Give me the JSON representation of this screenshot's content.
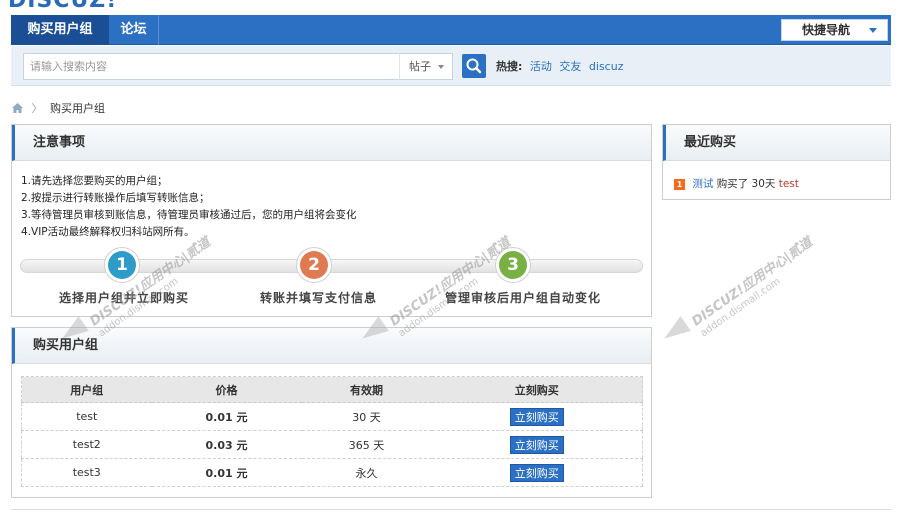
{
  "nav": {
    "logo": "DISCUZ!",
    "active_tab": "购买用户组",
    "forum_tab": "论坛",
    "quick_nav": "快捷导航"
  },
  "search": {
    "placeholder": "请输入搜索内容",
    "type": "帖子",
    "hot_label": "热搜:",
    "hot_terms": [
      "活动",
      "交友",
      "discuz"
    ]
  },
  "breadcrumb": {
    "current": "购买用户组"
  },
  "notice": {
    "title": "注意事项",
    "lines": [
      "1.请先选择您要购买的用户组；",
      "2.按提示进行转账操作后填写转账信息；",
      "3.等待管理员审核到账信息，待管理员审核通过后，您的用户组将会变化",
      "4.VIP活动最终解释权归科站网所有。"
    ],
    "steps": [
      {
        "num": "1",
        "label": "选择用户组并立即购买",
        "color": "#2f9bc9"
      },
      {
        "num": "2",
        "label": "转账并填写支付信息",
        "color": "#e07a50"
      },
      {
        "num": "3",
        "label": "管理审核后用户组自动变化",
        "color": "#79b043"
      }
    ]
  },
  "recent": {
    "title": "最近购买",
    "badge": "1",
    "user": "测试",
    "action": "购买了 30天",
    "group": "test"
  },
  "buy": {
    "title": "购买用户组",
    "headers": [
      "用户组",
      "价格",
      "有效期",
      "立刻购买"
    ],
    "rows": [
      {
        "group": "test",
        "price": "0.01 元",
        "period": "30 天",
        "button": "立刻购买"
      },
      {
        "group": "test2",
        "price": "0.03 元",
        "period": "365 天",
        "button": "立刻购买"
      },
      {
        "group": "test3",
        "price": "0.01 元",
        "period": "永久",
        "button": "立刻购买"
      }
    ]
  },
  "watermark": {
    "brand": "DISCUZ!应用中心|贰道",
    "url": "addon.dismall.com"
  },
  "colors": {
    "accent": "#2b70c2",
    "price": "#e00000",
    "badge": "#f26c1c"
  }
}
